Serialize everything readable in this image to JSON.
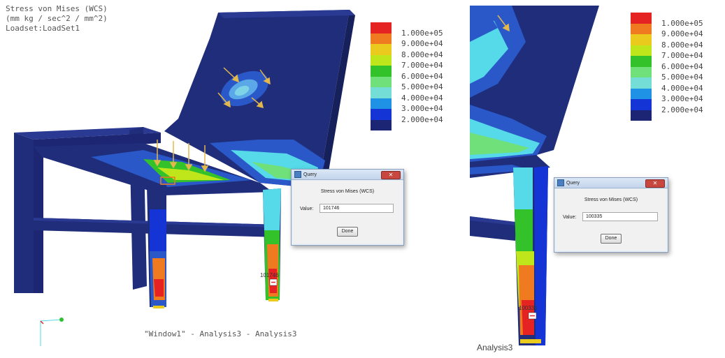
{
  "left": {
    "title_lines": [
      "Stress von Mises (WCS)",
      "(mm kg / sec^2 / mm^2)",
      "Loadset:LoadSet1"
    ],
    "legend": {
      "labels": [
        "1.000e+05",
        "9.000e+04",
        "8.000e+04",
        "7.000e+04",
        "6.000e+04",
        "5.000e+04",
        "4.000e+04",
        "3.000e+04",
        "2.000e+04"
      ],
      "colors": [
        "#e52323",
        "#ef7a1f",
        "#eaca1c",
        "#bfe61b",
        "#33c22a",
        "#6fe07a",
        "#74ddd5",
        "#1f92e6",
        "#1434d6",
        "#1c2474"
      ]
    },
    "query": {
      "title": "Query",
      "heading": "Stress von Mises (WCS)",
      "value_label": "Value:",
      "value": "101746",
      "done_label": "Done"
    },
    "window_caption": "\"Window1\" - Analysis3 - Analysis3"
  },
  "right": {
    "legend": {
      "labels": [
        "1.000e+05",
        "9.000e+04",
        "8.000e+04",
        "7.000e+04",
        "6.000e+04",
        "5.000e+04",
        "4.000e+04",
        "3.000e+04",
        "2.000e+04"
      ],
      "colors": [
        "#e52323",
        "#ef7a1f",
        "#eaca1c",
        "#bfe61b",
        "#33c22a",
        "#6fe07a",
        "#74ddd5",
        "#1f92e6",
        "#1434d6",
        "#1c2474"
      ]
    },
    "query": {
      "title": "Query",
      "heading": "Stress von Mises (WCS)",
      "value_label": "Value:",
      "value": "100335",
      "done_label": "Done"
    },
    "caption": "Analysis3"
  },
  "colors": {
    "model_navy": "#1f2d7a",
    "model_dark": "#16205a",
    "model_blue": "#2a58c8",
    "accent_cyan": "#56d9e8"
  },
  "icons": [
    "app-icon",
    "close-icon",
    "axis-triad-icon",
    "load-arrow-icon",
    "query-marker-icon"
  ]
}
